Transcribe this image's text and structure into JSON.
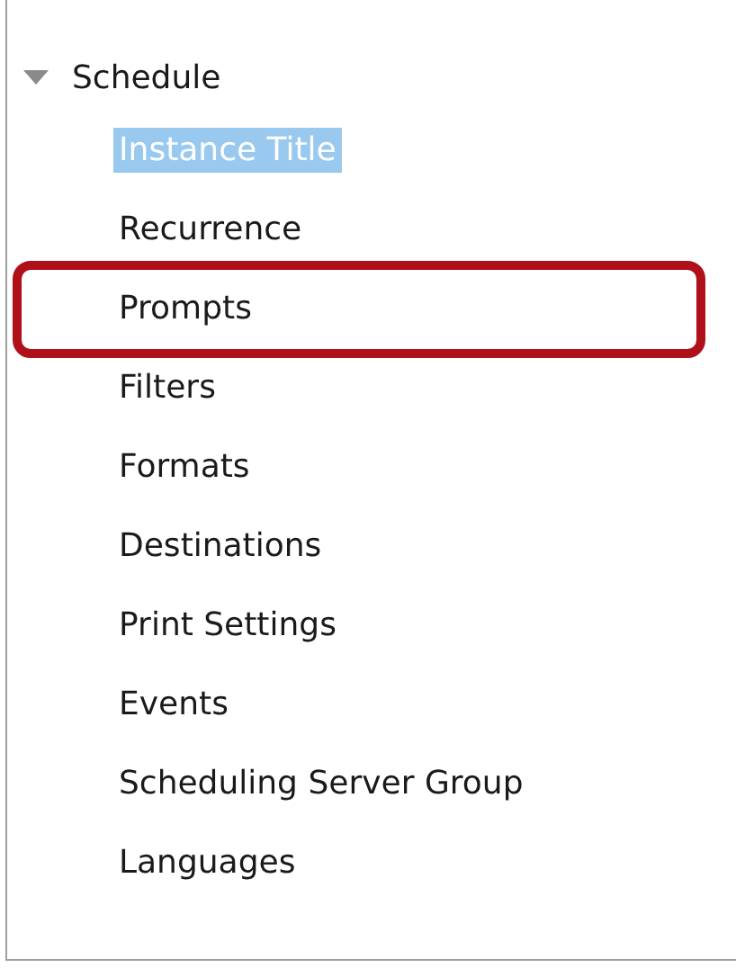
{
  "tree": {
    "label": "Schedule",
    "expanded": true,
    "children": [
      {
        "label": "Instance Title",
        "selected": true,
        "annotated": false
      },
      {
        "label": "Recurrence",
        "selected": false,
        "annotated": false
      },
      {
        "label": "Prompts",
        "selected": false,
        "annotated": true
      },
      {
        "label": "Filters",
        "selected": false,
        "annotated": false
      },
      {
        "label": "Formats",
        "selected": false,
        "annotated": false
      },
      {
        "label": "Destinations",
        "selected": false,
        "annotated": false
      },
      {
        "label": "Print Settings",
        "selected": false,
        "annotated": false
      },
      {
        "label": "Events",
        "selected": false,
        "annotated": false
      },
      {
        "label": "Scheduling Server Group",
        "selected": false,
        "annotated": false
      },
      {
        "label": "Languages",
        "selected": false,
        "annotated": false
      }
    ]
  }
}
